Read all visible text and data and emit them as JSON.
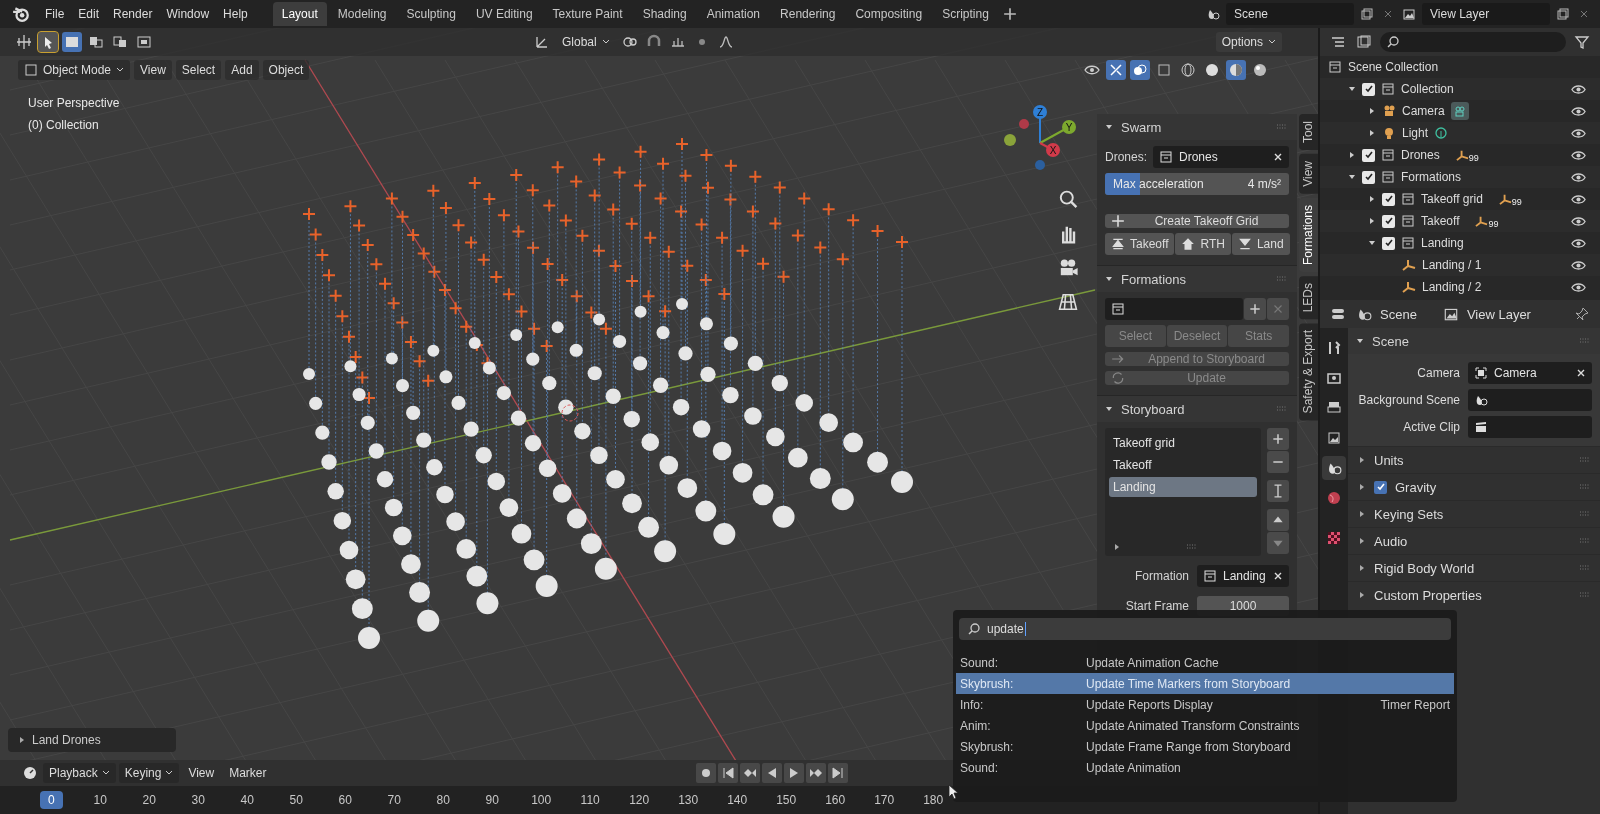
{
  "menu": [
    "File",
    "Edit",
    "Render",
    "Window",
    "Help"
  ],
  "workspace_tabs": [
    {
      "label": "Layout",
      "selected": true
    },
    {
      "label": "Modeling",
      "selected": false
    },
    {
      "label": "Sculpting",
      "selected": false
    },
    {
      "label": "UV Editing",
      "selected": false
    },
    {
      "label": "Texture Paint",
      "selected": false
    },
    {
      "label": "Shading",
      "selected": false
    },
    {
      "label": "Animation",
      "selected": false
    },
    {
      "label": "Rendering",
      "selected": false
    },
    {
      "label": "Compositing",
      "selected": false
    },
    {
      "label": "Scripting",
      "selected": false
    }
  ],
  "scene": "Scene",
  "view_layer": "View Layer",
  "tool_header": {
    "orientation": "Global",
    "options": "Options"
  },
  "viewport_header": {
    "mode": "Object Mode",
    "menus": [
      "View",
      "Select",
      "Add",
      "Object"
    ]
  },
  "viewport_info": [
    "User Perspective",
    "(0) Collection"
  ],
  "gizmo": {
    "x": "X",
    "y": "Y",
    "z": "Z"
  },
  "last_operator": "Land Drones",
  "sidebar_tabs": [
    {
      "label": "Tool",
      "selected": false
    },
    {
      "label": "View",
      "selected": false
    },
    {
      "label": "Formations",
      "selected": true
    },
    {
      "label": "LEDs",
      "selected": false
    },
    {
      "label": "Safety & Export",
      "selected": false
    }
  ],
  "swarm": {
    "title": "Swarm",
    "expanded": true,
    "drones_label": "Drones:",
    "drones_value": "Drones",
    "max_acceleration": {
      "label": "Max acceleration",
      "value": "4 m/s²",
      "level": 0.19
    },
    "create_button": "Create Takeoff Grid",
    "actions": [
      {
        "label": "Takeoff",
        "kind": "takeoff"
      },
      {
        "label": "RTH",
        "kind": "home"
      },
      {
        "label": "Land",
        "kind": "land"
      }
    ]
  },
  "formations": {
    "title": "Formations",
    "expanded": true,
    "buttons": [
      {
        "label": "Select",
        "disabled": true
      },
      {
        "label": "Deselect",
        "disabled": true
      },
      {
        "label": "Stats",
        "disabled": true
      }
    ],
    "append_button": {
      "label": "Append to Storyboard",
      "disabled": true
    },
    "update_button": {
      "label": "Update",
      "disabled": true
    }
  },
  "storyboard": {
    "title": "Storyboard",
    "expanded": true,
    "items": [
      {
        "label": "Takeoff grid",
        "selected": false
      },
      {
        "label": "Takeoff",
        "selected": false
      },
      {
        "label": "Landing",
        "selected": true
      }
    ],
    "formation_label": "Formation",
    "formation_value": "Landing",
    "start_frame_label": "Start Frame",
    "start_frame_value": "1000"
  },
  "outliner": {
    "root": "Scene Collection",
    "items": [
      {
        "label": "Collection",
        "kind": "collection",
        "checked": true,
        "expanded": true,
        "children": [
          {
            "label": "Camera",
            "kind": "camera",
            "expanded": false
          },
          {
            "label": "Light",
            "kind": "light",
            "expanded": false
          }
        ]
      },
      {
        "label": "Drones",
        "kind": "collection",
        "checked": true,
        "expanded": false,
        "badge": "99"
      },
      {
        "label": "Formations",
        "kind": "collection",
        "checked": true,
        "expanded": true,
        "children": [
          {
            "label": "Takeoff grid",
            "kind": "collection",
            "checked": true,
            "expanded": false,
            "badge": "99"
          },
          {
            "label": "Takeoff",
            "kind": "collection",
            "checked": true,
            "expanded": false,
            "badge": "99"
          },
          {
            "label": "Landing",
            "kind": "collection",
            "checked": true,
            "expanded": true,
            "children": [
              {
                "label": "Landing / 1",
                "kind": "empty"
              },
              {
                "label": "Landing / 2",
                "kind": "empty"
              }
            ]
          }
        ]
      }
    ]
  },
  "properties": {
    "tabs": [
      "Scene",
      "View Layer"
    ],
    "panel_title": "Scene",
    "fields": [
      {
        "label": "Camera",
        "kind": "camera",
        "value": "Camera"
      },
      {
        "label": "Background Scene",
        "kind": "scene"
      },
      {
        "label": "Active Clip",
        "kind": "clip"
      }
    ],
    "subpanels": [
      {
        "label": "Units",
        "kind": "plain"
      },
      {
        "label": "Gravity",
        "kind": "checkbox",
        "checked": true
      },
      {
        "label": "Keying Sets",
        "kind": "plain"
      },
      {
        "label": "Audio",
        "kind": "plain"
      },
      {
        "label": "Rigid Body World",
        "kind": "plain"
      },
      {
        "label": "Custom Properties",
        "kind": "plain"
      }
    ]
  },
  "search": {
    "query": "update",
    "results": [
      {
        "category": "Sound:",
        "label": "Update Animation Cache",
        "selected": false
      },
      {
        "category": "Skybrush:",
        "label": "Update Time Markers from Storyboard",
        "selected": true
      },
      {
        "category": "Info:",
        "label": "Update Reports Display",
        "shortcut": "Timer Report",
        "selected": false
      },
      {
        "category": "Anim:",
        "label": "Update Animated Transform Constraints",
        "selected": false
      },
      {
        "category": "Skybrush:",
        "label": "Update Frame Range from Storyboard",
        "selected": false
      },
      {
        "category": "Sound:",
        "label": "Update Animation",
        "selected": false
      }
    ]
  },
  "timeline": {
    "menus": [
      {
        "label": "Playback",
        "dropdown": true
      },
      {
        "label": "Keying",
        "dropdown": true
      },
      {
        "label": "View",
        "dropdown": false
      },
      {
        "label": "Marker",
        "dropdown": false
      }
    ],
    "frames": [
      {
        "label": "0",
        "selected": true
      },
      {
        "label": "10",
        "selected": false
      },
      {
        "label": "20",
        "selected": false
      },
      {
        "label": "30",
        "selected": false
      },
      {
        "label": "40",
        "selected": false
      },
      {
        "label": "50",
        "selected": false
      },
      {
        "label": "60",
        "selected": false
      },
      {
        "label": "70",
        "selected": false
      },
      {
        "label": "80",
        "selected": false
      },
      {
        "label": "90",
        "selected": false
      },
      {
        "label": "100",
        "selected": false
      },
      {
        "label": "110",
        "selected": false
      },
      {
        "label": "120",
        "selected": false
      },
      {
        "label": "130",
        "selected": false
      },
      {
        "label": "140",
        "selected": false
      },
      {
        "label": "150",
        "selected": false
      },
      {
        "label": "160",
        "selected": false
      },
      {
        "label": "170",
        "selected": false
      },
      {
        "label": "180",
        "selected": false
      }
    ]
  }
}
